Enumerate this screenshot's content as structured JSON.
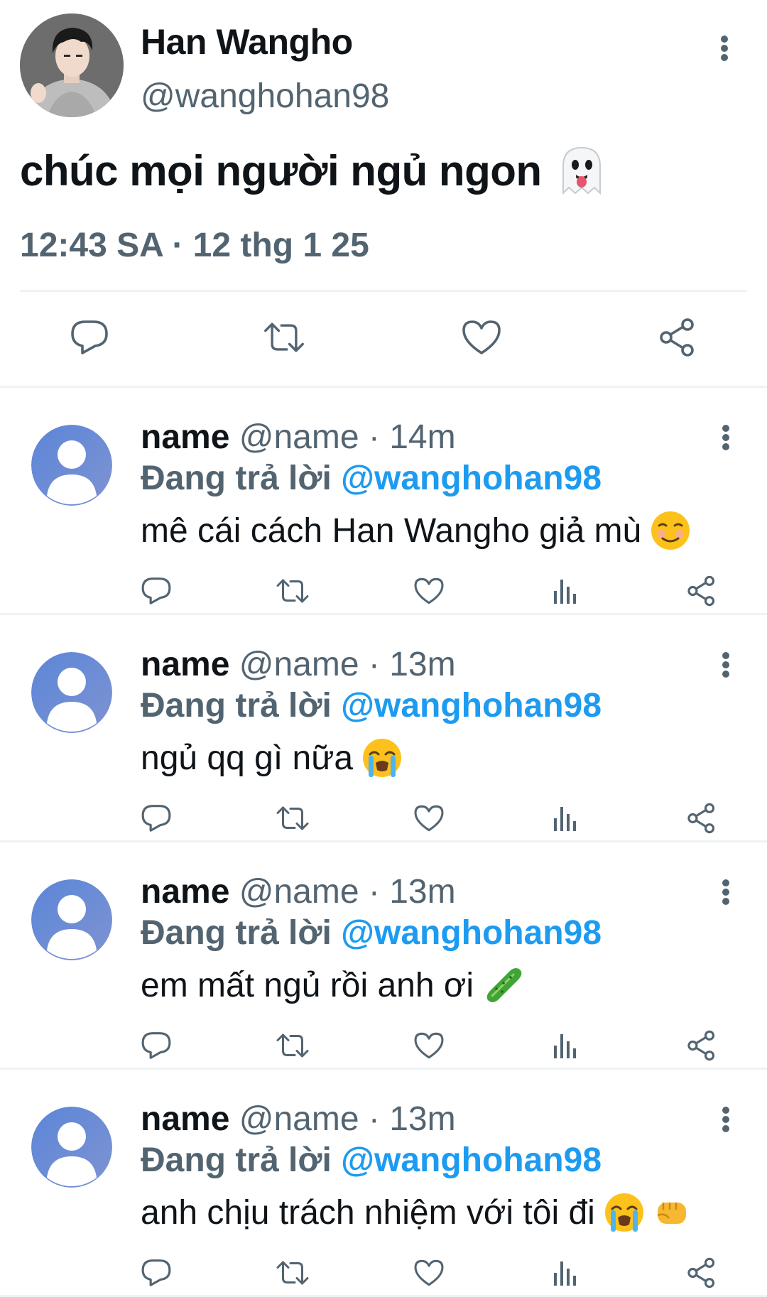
{
  "colors": {
    "text": "#0f1419",
    "secondary": "#536471",
    "accent": "#1d9bf0",
    "divider": "#eff3f4",
    "avatar_placeholder": "#6f8fd6"
  },
  "tweet": {
    "author_name": "Han Wangho",
    "author_handle": "@wanghohan98",
    "text": "chúc mọi người ngủ ngon",
    "text_emoji": "ghost-tongue-emoji",
    "timestamp": "12:43 SA · 12 thg 1 25",
    "actions": [
      "reply-icon",
      "retweet-icon",
      "like-icon",
      "share-icon"
    ]
  },
  "replies": [
    {
      "name": "name",
      "handle": "@name",
      "dot": "·",
      "time": "14m",
      "replying_label": "Đang trả lời",
      "replying_to": "@wanghohan98",
      "text": "mê cái cách Han Wangho giả mù",
      "emojis": [
        "smiling-blush-emoji"
      ]
    },
    {
      "name": "name",
      "handle": "@name",
      "dot": "·",
      "time": "13m",
      "replying_label": "Đang trả lời",
      "replying_to": "@wanghohan98",
      "text": "ngủ qq gì nữa",
      "emojis": [
        "loudly-crying-emoji"
      ]
    },
    {
      "name": "name",
      "handle": "@name",
      "dot": "·",
      "time": "13m",
      "replying_label": "Đang trả lời",
      "replying_to": "@wanghohan98",
      "text": "em mất ngủ rồi anh ơi",
      "emojis": [
        "cucumber-emoji"
      ]
    },
    {
      "name": "name",
      "handle": "@name",
      "dot": "·",
      "time": "13m",
      "replying_label": "Đang trả lời",
      "replying_to": "@wanghohan98",
      "text": "anh chịu trách nhiệm với tôi đi",
      "emojis": [
        "loudly-crying-emoji",
        "fist-emoji"
      ]
    }
  ]
}
